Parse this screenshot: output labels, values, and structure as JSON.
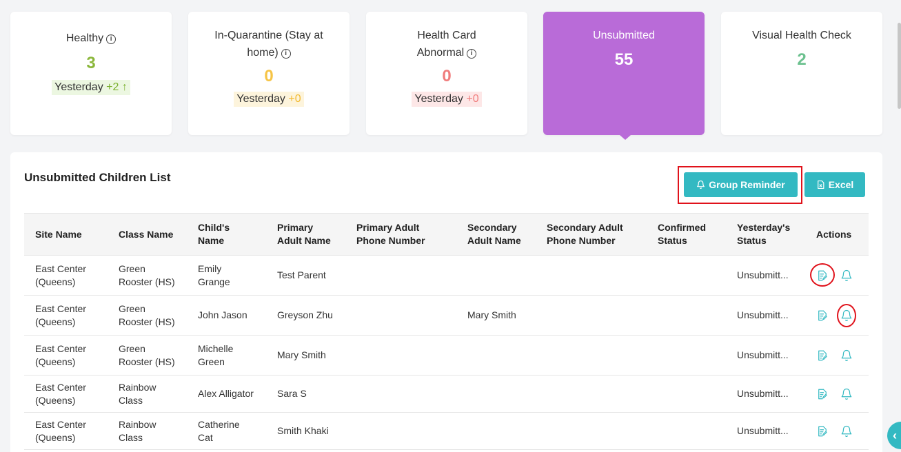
{
  "cards": [
    {
      "title": "Healthy",
      "value": "3",
      "value_color": "#8bb73b",
      "yesterday_label": "Yesterday",
      "yesterday_delta": "+2",
      "delta_color": "#7ab02e",
      "badge_bg": "#ecf7e1",
      "has_info": true,
      "arrow": "↑"
    },
    {
      "title": "In-Quarantine (Stay at home)",
      "value": "0",
      "value_color": "#f6c446",
      "yesterday_label": "Yesterday",
      "yesterday_delta": "+0",
      "delta_color": "#f2b92f",
      "badge_bg": "#fdf4dc",
      "has_info": true
    },
    {
      "title": "Health Card Abnormal",
      "value": "0",
      "value_color": "#f07c7c",
      "yesterday_label": "Yesterday",
      "yesterday_delta": "+0",
      "delta_color": "#f07c7c",
      "badge_bg": "#fde7e7",
      "has_info": true
    },
    {
      "title": "Unsubmitted",
      "value": "55",
      "active": true
    },
    {
      "title": "Visual Health Check",
      "value": "2",
      "value_color": "#6cc18f"
    }
  ],
  "panel": {
    "title": "Unsubmitted Children List",
    "group_reminder_label": "Group Reminder",
    "excel_label": "Excel"
  },
  "table": {
    "headers": [
      "Site Name",
      "Class Name",
      "Child's Name",
      "Primary Adult Name",
      "Primary Adult Phone Number",
      "Secondary Adult Name",
      "Secondary Adult Phone Number",
      "Confirmed Status",
      "Yesterday's Status",
      "Actions"
    ],
    "rows": [
      {
        "site": "East Center (Queens)",
        "class": "Green Rooster (HS)",
        "child": "Emily Grange",
        "primary": "Test Parent",
        "primary_phone": "",
        "secondary": "",
        "secondary_phone": "",
        "confirmed": "",
        "yesterday": "Unsubmitt..."
      },
      {
        "site": "East Center (Queens)",
        "class": "Green Rooster (HS)",
        "child": "John Jason",
        "primary": "Greyson Zhu",
        "primary_phone": "",
        "secondary": "Mary Smith",
        "secondary_phone": "",
        "confirmed": "",
        "yesterday": "Unsubmitt..."
      },
      {
        "site": "East Center (Queens)",
        "class": "Green Rooster (HS)",
        "child": "Michelle Green",
        "primary": "Mary Smith",
        "primary_phone": "",
        "secondary": "",
        "secondary_phone": "",
        "confirmed": "",
        "yesterday": "Unsubmitt..."
      },
      {
        "site": "East Center (Queens)",
        "class": "Rainbow Class",
        "child": "Alex Alligator",
        "primary": "Sara S",
        "primary_phone": "",
        "secondary": "",
        "secondary_phone": "",
        "confirmed": "",
        "yesterday": "Unsubmitt..."
      },
      {
        "site": "East Center (Queens)",
        "class": "Rainbow Class",
        "child": "Catherine Cat",
        "primary": "Smith Khaki",
        "primary_phone": "",
        "secondary": "",
        "secondary_phone": "",
        "confirmed": "",
        "yesterday": "Unsubmitt..."
      }
    ]
  },
  "colors": {
    "accent": "#33b9c2",
    "active_card": "#b96bd8",
    "annotation_red": "#e0121b"
  }
}
